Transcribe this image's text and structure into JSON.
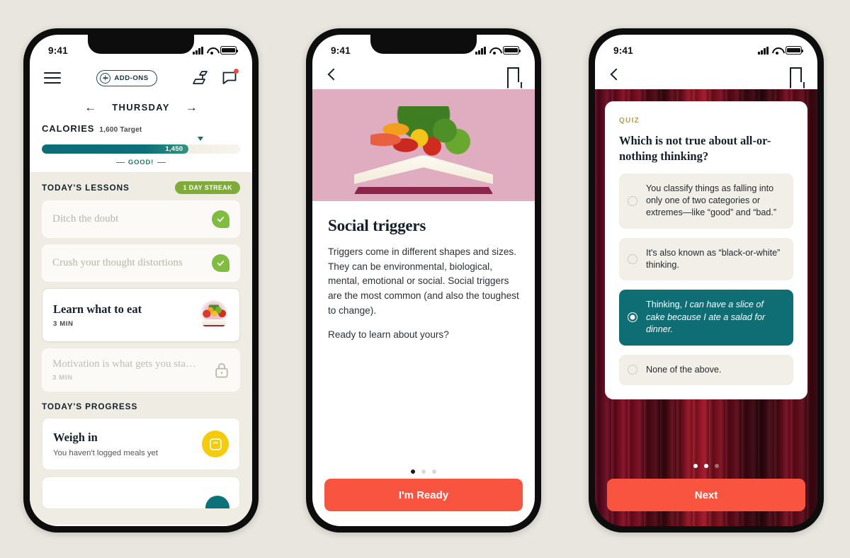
{
  "canvas": {
    "background": "#e9e6df"
  },
  "colors": {
    "teal": "#0e6e73",
    "red_cta": "#f85440",
    "green_streak": "#7fab3a",
    "yellow": "#f5cb0e",
    "pink_hero": "#dfacc0",
    "quiz_kicker": "#b09b5e"
  },
  "phone1": {
    "status": {
      "time": "9:41",
      "signal_icon": "cellular-bars-icon",
      "wifi_icon": "wifi-icon",
      "battery_icon": "battery-icon"
    },
    "topbar": {
      "menu_icon": "hamburger-menu-icon",
      "addons_label": "ADD-ONS",
      "addons_plus_icon": "plus-circle-icon",
      "scale_icon": "scale-icon",
      "chat_icon": "chat-bubble-icon",
      "chat_has_badge": true
    },
    "daynav": {
      "prev_icon": "arrow-left-icon",
      "day": "THURSDAY",
      "next_icon": "arrow-right-icon"
    },
    "calories": {
      "title": "CALORIES",
      "target": "1,600 Target",
      "value": "1,450",
      "fill_percent": 74,
      "marker_percent": 80,
      "status": "GOOD!"
    },
    "lessons": {
      "section_title": "TODAY'S LESSONS",
      "streak_badge": "1 DAY STREAK",
      "items": [
        {
          "title": "Ditch the doubt",
          "duration": "",
          "state": "done",
          "icon": "check-circle-icon"
        },
        {
          "title": "Crush your thought distortions",
          "duration": "",
          "state": "done",
          "icon": "check-circle-icon"
        },
        {
          "title": "Learn what to eat",
          "duration": "3 MIN",
          "state": "active",
          "icon": "lesson-thumbnail"
        },
        {
          "title": "Motivation is what gets you sta…",
          "duration": "3 MIN",
          "state": "locked",
          "icon": "lock-icon"
        }
      ]
    },
    "progress": {
      "section_title": "TODAY'S PROGRESS",
      "card": {
        "title": "Weigh in",
        "subtitle": "You haven't logged meals yet",
        "icon": "scale-circle-icon"
      }
    }
  },
  "phone2": {
    "status": {
      "time": "9:41"
    },
    "navbar": {
      "back_icon": "chevron-left-icon",
      "bookmark_icon": "bookmark-icon"
    },
    "hero": {
      "image": "vegetables-on-open-book-illustration",
      "background": "#dfacc0"
    },
    "article": {
      "title": "Social triggers",
      "paragraph1": "Triggers come in different shapes and sizes. They can be environmental, biological, mental, emotional or social. Social triggers are the most common (and also the toughest to change).",
      "paragraph2": "Ready to learn about yours?"
    },
    "pager": {
      "total": 3,
      "active_index": 0
    },
    "cta_label": "I'm Ready"
  },
  "phone3": {
    "status": {
      "time": "9:41"
    },
    "navbar": {
      "back_icon": "chevron-left-icon",
      "bookmark_icon": "bookmark-icon"
    },
    "background": "dark-red-curtain-texture",
    "quiz": {
      "kicker": "QUIZ",
      "question": "Which is not true about all-or-nothing thinking?",
      "options": [
        {
          "text": "You classify things as falling into only one of two categories or extremes—like “good” and “bad.”",
          "selected": false
        },
        {
          "text": "It's also known as “black-or-white” thinking.",
          "selected": false
        },
        {
          "text_pre": "Thinking, ",
          "text_em": "I can have a slice of cake because I ate a salad for dinner.",
          "selected": true
        },
        {
          "text": "None of the above.",
          "selected": false
        }
      ]
    },
    "pager": {
      "total": 3,
      "active_count": 2
    },
    "cta_label": "Next"
  }
}
